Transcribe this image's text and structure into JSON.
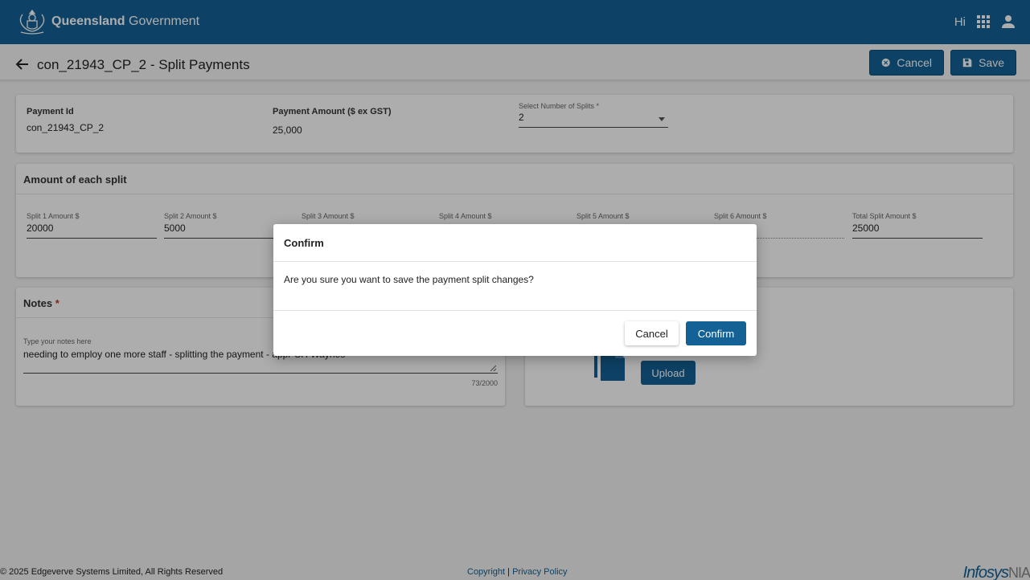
{
  "header": {
    "brand_bold": "Queensland",
    "brand_light": "Government",
    "greeting": "Hi"
  },
  "page": {
    "title": "con_21943_CP_2 - Split Payments",
    "cancel_label": "Cancel",
    "save_label": "Save"
  },
  "payment": {
    "id_label": "Payment Id",
    "id_value": "con_21943_CP_2",
    "amount_label": "Payment Amount ($ ex GST)",
    "amount_value": "25,000",
    "splits_label": "Select Number of Splits *",
    "splits_value": "2"
  },
  "splits": {
    "title": "Amount of each split",
    "items": [
      {
        "label": "Split 1 Amount $",
        "value": "20000"
      },
      {
        "label": "Split 2 Amount $",
        "value": "5000"
      },
      {
        "label": "Split 3 Amount $",
        "value": ""
      },
      {
        "label": "Split 4 Amount $",
        "value": ""
      },
      {
        "label": "Split 5 Amount $",
        "value": ""
      },
      {
        "label": "Split 6 Amount $",
        "value": ""
      }
    ],
    "total_label": "Total Split Amount $",
    "total_value": "25000"
  },
  "notes": {
    "title": "Notes",
    "required_mark": "*",
    "placeholder": "Type your notes here",
    "value": "needing to employ one more staff - splitting the payment - appr CH Waynes",
    "counter": "73/2000"
  },
  "attachments": {
    "upload_label": "Upload"
  },
  "dialog": {
    "title": "Confirm",
    "message": "Are you sure you want to save the payment split changes?",
    "cancel_label": "Cancel",
    "confirm_label": "Confirm"
  },
  "footer": {
    "copyright": "© 2025 Edgeverve Systems Limited, All Rights Reserved",
    "link_copyright": "Copyright",
    "separator": "|",
    "link_privacy": "Privacy Policy",
    "logo_main": "Infosys",
    "logo_sub": "NIA"
  },
  "colors": {
    "primary": "#146195",
    "required": "#c0392b",
    "background": "#f3f3f3"
  }
}
